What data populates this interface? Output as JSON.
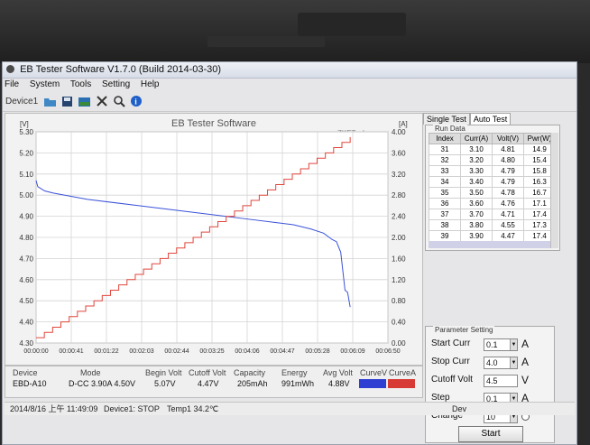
{
  "window": {
    "title": "EB Tester Software V1.7.0 (Build 2014-03-30)"
  },
  "menu": [
    "File",
    "System",
    "Tools",
    "Setting",
    "Help"
  ],
  "toolbar": {
    "device_label": "Device1"
  },
  "chart_data": {
    "type": "line",
    "title": "EB Tester Software",
    "watermark": "ZKETech",
    "left_unit": "[V]",
    "right_unit": "[A]",
    "ylim_left": [
      4.3,
      5.3
    ],
    "ylim_right": [
      0,
      4.0
    ],
    "yticks_left": [
      "5.30",
      "5.20",
      "5.10",
      "5.00",
      "4.90",
      "4.80",
      "4.70",
      "4.60",
      "4.50",
      "4.40",
      "4.30"
    ],
    "yticks_right": [
      "4.00",
      "3.60",
      "3.20",
      "2.80",
      "2.40",
      "2.00",
      "1.60",
      "1.20",
      "0.80",
      "0.40",
      "0.00"
    ],
    "xticks": [
      "00:00:00",
      "00:00:41",
      "00:01:22",
      "00:02:03",
      "00:02:44",
      "00:03:25",
      "00:04:06",
      "00:04:47",
      "00:05:28",
      "00:06:09",
      "00:06:50"
    ],
    "xlim_seconds": [
      0,
      410
    ],
    "grid": true,
    "series": [
      {
        "name": "CurveV",
        "axis": "left",
        "color": "#3a52d8",
        "x": [
          0,
          2,
          10,
          20,
          60,
          120,
          180,
          240,
          280,
          300,
          320,
          335,
          345,
          350,
          355,
          360,
          363,
          366
        ],
        "y": [
          5.07,
          5.04,
          5.02,
          5.01,
          4.98,
          4.95,
          4.92,
          4.89,
          4.87,
          4.86,
          4.84,
          4.82,
          4.79,
          4.78,
          4.73,
          4.55,
          4.54,
          4.47
        ]
      },
      {
        "name": "CurveA",
        "axis": "right",
        "color": "#e0463c",
        "x": [
          0,
          366
        ],
        "y": [
          0.1,
          3.9
        ]
      }
    ]
  },
  "tabs": [
    "Single Test",
    "Auto Test"
  ],
  "run_data": {
    "title": "Run Data",
    "headers": [
      "Index",
      "Curr(A)",
      "Volt(V)",
      "Pwr(W)"
    ],
    "rows": [
      [
        "31",
        "3.10",
        "4.81",
        "14.9"
      ],
      [
        "32",
        "3.20",
        "4.80",
        "15.4"
      ],
      [
        "33",
        "3.30",
        "4.79",
        "15.8"
      ],
      [
        "34",
        "3.40",
        "4.79",
        "16.3"
      ],
      [
        "35",
        "3.50",
        "4.78",
        "16.7"
      ],
      [
        "36",
        "3.60",
        "4.76",
        "17.1"
      ],
      [
        "37",
        "3.70",
        "4.71",
        "17.4"
      ],
      [
        "38",
        "3.80",
        "4.55",
        "17.3"
      ],
      [
        "39",
        "3.90",
        "4.47",
        "17.4"
      ]
    ]
  },
  "params": {
    "title": "Parameter Setting",
    "start_label": "Start Curr",
    "start_value": "0.1",
    "start_unit": "A",
    "stop_label": "Stop Curr",
    "stop_value": "4.0",
    "stop_unit": "A",
    "cutoff_label": "Cutoff Volt",
    "cutoff_value": "4.5",
    "cutoff_unit": "V",
    "step_label": "Step",
    "step_value": "0.1",
    "step_unit": "A",
    "change_label": "Change",
    "change_value": "10",
    "start_button": "Start"
  },
  "info": {
    "headers": [
      "Device",
      "Mode",
      "Begin Volt",
      "Cutoff Volt",
      "Capacity",
      "Energy",
      "Avg Volt",
      "CurveV",
      "CurveA"
    ],
    "values": [
      "EBD-A10",
      "D-CC  3.90A  4.50V",
      "5.07V",
      "4.47V",
      "205mAh",
      "991mWh",
      "4.88V"
    ],
    "curve_v_color": "#2f3fd2",
    "curve_a_color": "#d73a34"
  },
  "status": {
    "datetime": "2014/8/16 上午 11:49:09",
    "device_state": "Device1: STOP",
    "temp": "Temp1  34.2℃",
    "right_text": "Dev"
  }
}
